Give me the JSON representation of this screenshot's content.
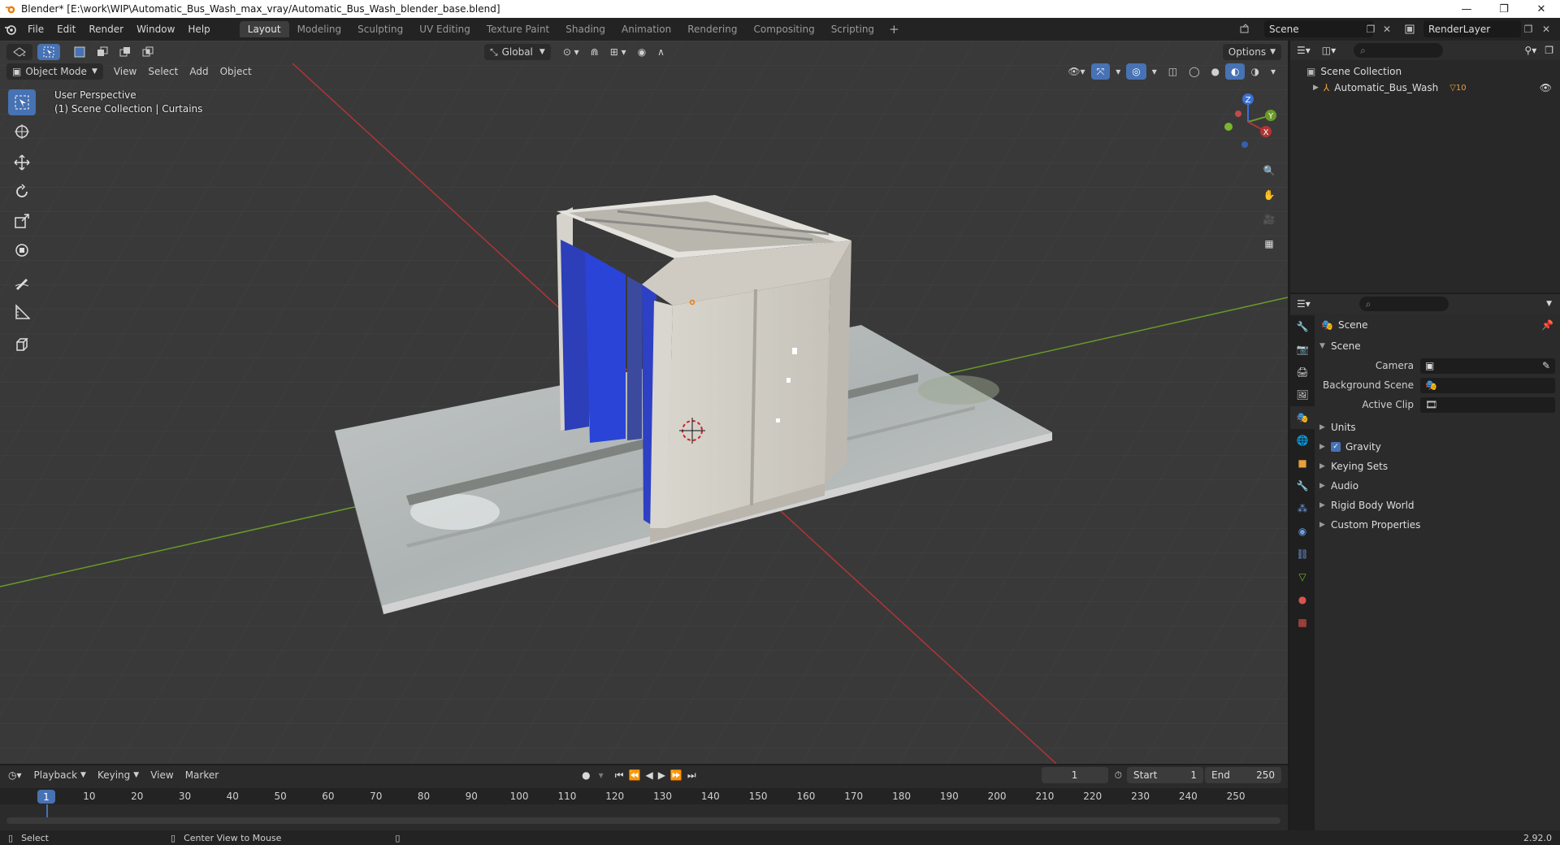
{
  "window": {
    "title": "Blender* [E:\\work\\WIP\\Automatic_Bus_Wash_max_vray/Automatic_Bus_Wash_blender_base.blend]",
    "minimize": "—",
    "restore": "❐",
    "close": "✕"
  },
  "menu": {
    "items": [
      "File",
      "Edit",
      "Render",
      "Window",
      "Help"
    ],
    "workspaces": [
      "Layout",
      "Modeling",
      "Sculpting",
      "UV Editing",
      "Texture Paint",
      "Shading",
      "Animation",
      "Rendering",
      "Compositing",
      "Scripting"
    ],
    "active_workspace": "Layout",
    "add_workspace": "+",
    "scene": "Scene",
    "view_layer": "RenderLayer"
  },
  "viewport": {
    "mode": "Object Mode",
    "menus": [
      "View",
      "Select",
      "Add",
      "Object"
    ],
    "orientation": "Global",
    "options": "Options",
    "perspective_label": "User Perspective",
    "collection_label": "(1) Scene Collection | Curtains",
    "gizmo_axes": {
      "z": "Z",
      "y": "Y",
      "x": "X"
    }
  },
  "outliner": {
    "root": "Scene Collection",
    "items": [
      {
        "name": "Automatic_Bus_Wash",
        "badge": "10"
      }
    ]
  },
  "properties": {
    "context": "Scene",
    "panel": "Scene",
    "fields": [
      {
        "label": "Camera",
        "value": ""
      },
      {
        "label": "Background Scene",
        "value": ""
      },
      {
        "label": "Active Clip",
        "value": ""
      }
    ],
    "subpanels": [
      "Units",
      "Gravity",
      "Keying Sets",
      "Audio",
      "Rigid Body World",
      "Custom Properties"
    ],
    "gravity_checked": true
  },
  "timeline": {
    "menus": [
      "Playback",
      "Keying",
      "View",
      "Marker"
    ],
    "current_frame": "1",
    "start_label": "Start",
    "start": "1",
    "end_label": "End",
    "end": "250",
    "ruler": [
      "1",
      "10",
      "20",
      "30",
      "40",
      "50",
      "60",
      "70",
      "80",
      "90",
      "100",
      "110",
      "120",
      "130",
      "140",
      "150",
      "160",
      "170",
      "180",
      "190",
      "200",
      "210",
      "220",
      "230",
      "240",
      "250"
    ]
  },
  "status": {
    "left": "Select",
    "middle": "Center View to Mouse",
    "version": "2.92.0"
  },
  "colors": {
    "accent": "#4772b3",
    "x_axis": "#b03535",
    "y_axis": "#6a9a2a",
    "z_axis": "#3b6fd1"
  }
}
